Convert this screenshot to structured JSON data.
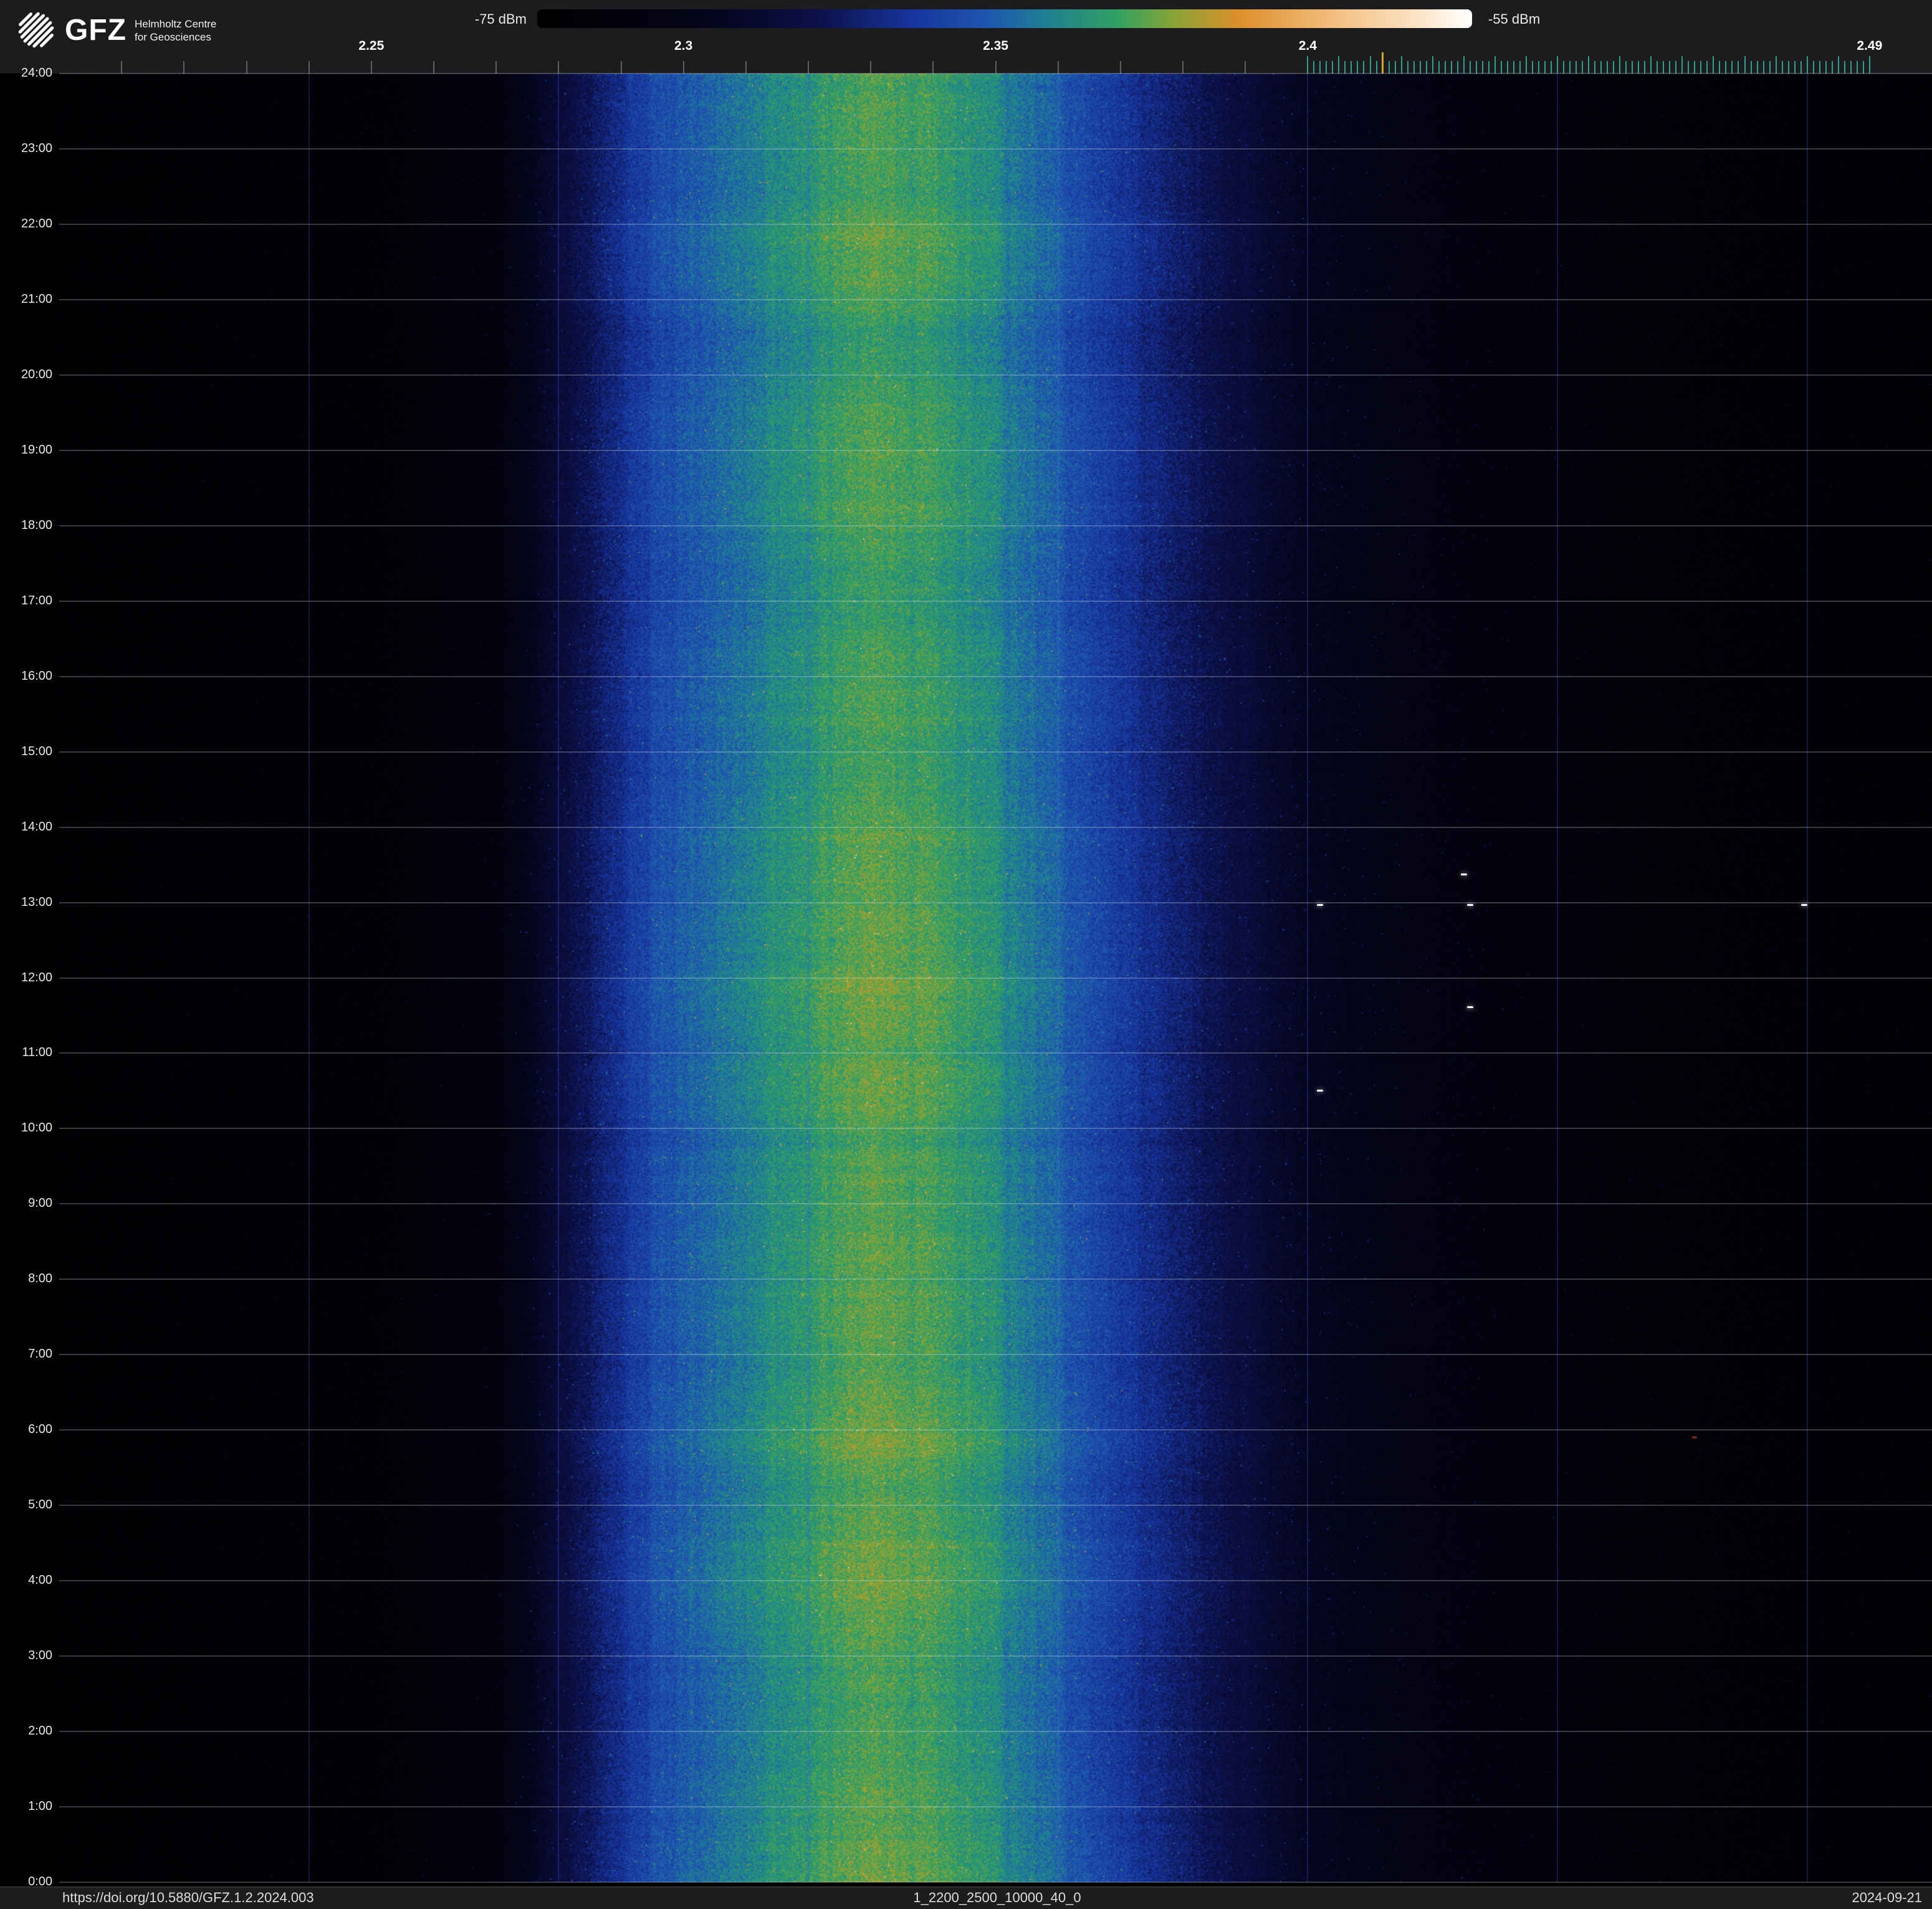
{
  "header": {
    "logo": {
      "text": "GFZ",
      "subtitle": [
        "Helmholtz Centre",
        "for Geosciences"
      ]
    },
    "colorbar": {
      "min_label": "-75 dBm",
      "max_label": "-55 dBm"
    }
  },
  "chart_data": {
    "type": "heatmap",
    "description": "24-hour radio-frequency spectrogram waterfall: frequency (GHz) on x-axis, time of day on y-axis (24:00 top to 0:00 bottom), received power (dBm) as color. Broad emission band centered near 2.33 GHz.",
    "x_axis": {
      "unit": "GHz",
      "min": 2.2,
      "max": 2.5,
      "tick_labels": [
        {
          "label": "2.25",
          "ghz": 2.25
        },
        {
          "label": "2.3",
          "ghz": 2.3
        },
        {
          "label": "2.35",
          "ghz": 2.35
        },
        {
          "label": "2.4",
          "ghz": 2.4
        },
        {
          "label": "2.49",
          "ghz": 2.49
        }
      ],
      "minor_ticks": {
        "start": 2.21,
        "end": 2.39,
        "step": 0.01,
        "color": "#5f5f5f"
      },
      "channel_ticks": {
        "start": 2.4,
        "end": 2.49,
        "step": 0.001,
        "color": "#2fa08c",
        "highlight_color": "#d4a72c",
        "highlight": [
          2.412,
          2.4865
        ]
      }
    },
    "y_axis": {
      "unit": "time of day",
      "hour_labels": [
        "24:00",
        "23:00",
        "22:00",
        "21:00",
        "20:00",
        "19:00",
        "18:00",
        "17:00",
        "16:00",
        "15:00",
        "14:00",
        "13:00",
        "12:00",
        "11:00",
        "10:00",
        "9:00",
        "8:00",
        "7:00",
        "6:00",
        "5:00",
        "4:00",
        "3:00",
        "2:00",
        "1:00",
        "0:00"
      ]
    },
    "color_scale": {
      "min_dbm": -75,
      "max_dbm": -55,
      "stops": [
        {
          "v": 0.0,
          "c": "#000000"
        },
        {
          "v": 0.18,
          "c": "#04041a"
        },
        {
          "v": 0.3,
          "c": "#0c1048"
        },
        {
          "v": 0.4,
          "c": "#16349c"
        },
        {
          "v": 0.48,
          "c": "#1e55b0"
        },
        {
          "v": 0.55,
          "c": "#1f8290"
        },
        {
          "v": 0.62,
          "c": "#2fa061"
        },
        {
          "v": 0.68,
          "c": "#86a437"
        },
        {
          "v": 0.75,
          "c": "#dd8f2b"
        },
        {
          "v": 0.85,
          "c": "#f2bd7d"
        },
        {
          "v": 0.94,
          "c": "#fbe3c4"
        },
        {
          "v": 1.0,
          "c": "#ffffff"
        }
      ]
    },
    "v_gridlines_ghz": [
      2.24,
      2.28,
      2.32,
      2.36,
      2.4,
      2.44,
      2.48
    ],
    "spectrum_profile_dbm": [
      {
        "ghz": 2.2,
        "dbm": -74.6
      },
      {
        "ghz": 2.25,
        "dbm": -74.2
      },
      {
        "ghz": 2.27,
        "dbm": -73.0
      },
      {
        "ghz": 2.285,
        "dbm": -68.5
      },
      {
        "ghz": 2.296,
        "dbm": -66.0
      },
      {
        "ghz": 2.308,
        "dbm": -64.4
      },
      {
        "ghz": 2.318,
        "dbm": -63.2
      },
      {
        "ghz": 2.326,
        "dbm": -62.4
      },
      {
        "ghz": 2.332,
        "dbm": -62.1
      },
      {
        "ghz": 2.34,
        "dbm": -62.5
      },
      {
        "ghz": 2.349,
        "dbm": -63.4
      },
      {
        "ghz": 2.358,
        "dbm": -64.9
      },
      {
        "ghz": 2.37,
        "dbm": -66.8
      },
      {
        "ghz": 2.384,
        "dbm": -68.9
      },
      {
        "ghz": 2.4,
        "dbm": -71.2
      },
      {
        "ghz": 2.42,
        "dbm": -72.6
      },
      {
        "ghz": 2.445,
        "dbm": -73.6
      },
      {
        "ghz": 2.47,
        "dbm": -74.1
      },
      {
        "ghz": 2.5,
        "dbm": -74.4
      }
    ],
    "sparks": [
      {
        "ghz": 2.402,
        "hour": 12.96
      },
      {
        "ghz": 2.425,
        "hour": 13.37
      },
      {
        "ghz": 2.426,
        "hour": 12.96
      },
      {
        "ghz": 2.4795,
        "hour": 12.96
      },
      {
        "ghz": 2.426,
        "hour": 11.61
      },
      {
        "ghz": 2.402,
        "hour": 10.5
      }
    ],
    "ember": {
      "ghz": 2.462,
      "hour": 5.9
    }
  },
  "footer": {
    "doi": "https://doi.org/10.5880/GFZ.1.2.2024.003",
    "dataset_id": "1_2200_2500_10000_40_0",
    "date": "2024-09-21"
  }
}
